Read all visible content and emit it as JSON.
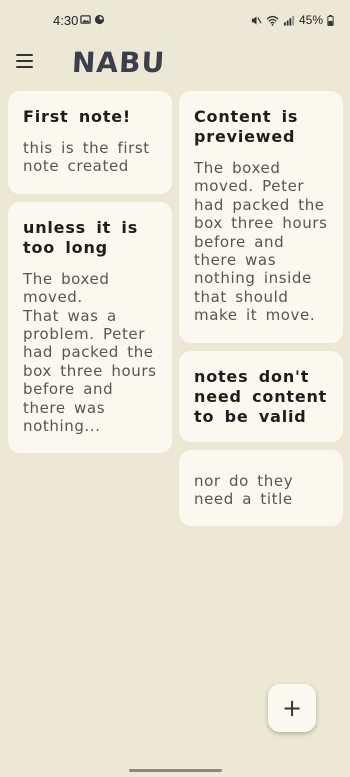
{
  "status_bar": {
    "time": "4:30",
    "battery": "45%"
  },
  "app": {
    "title": "NABU"
  },
  "notes": {
    "left": [
      {
        "title": "First note!",
        "body": "this is the first note created"
      },
      {
        "title": "unless it is too long",
        "body": "The boxed moved.\nThat was a problem. Peter had packed the box three hours before and there was nothing..."
      }
    ],
    "right": [
      {
        "title": "Content is previewed",
        "body": "The boxed moved. Peter had packed the box three hours before and there was nothing inside that should make it move."
      },
      {
        "title": "notes don't need content to be valid",
        "body": ""
      },
      {
        "title": "",
        "body": "nor do they need a title"
      }
    ]
  },
  "fab": {
    "label": "+"
  }
}
